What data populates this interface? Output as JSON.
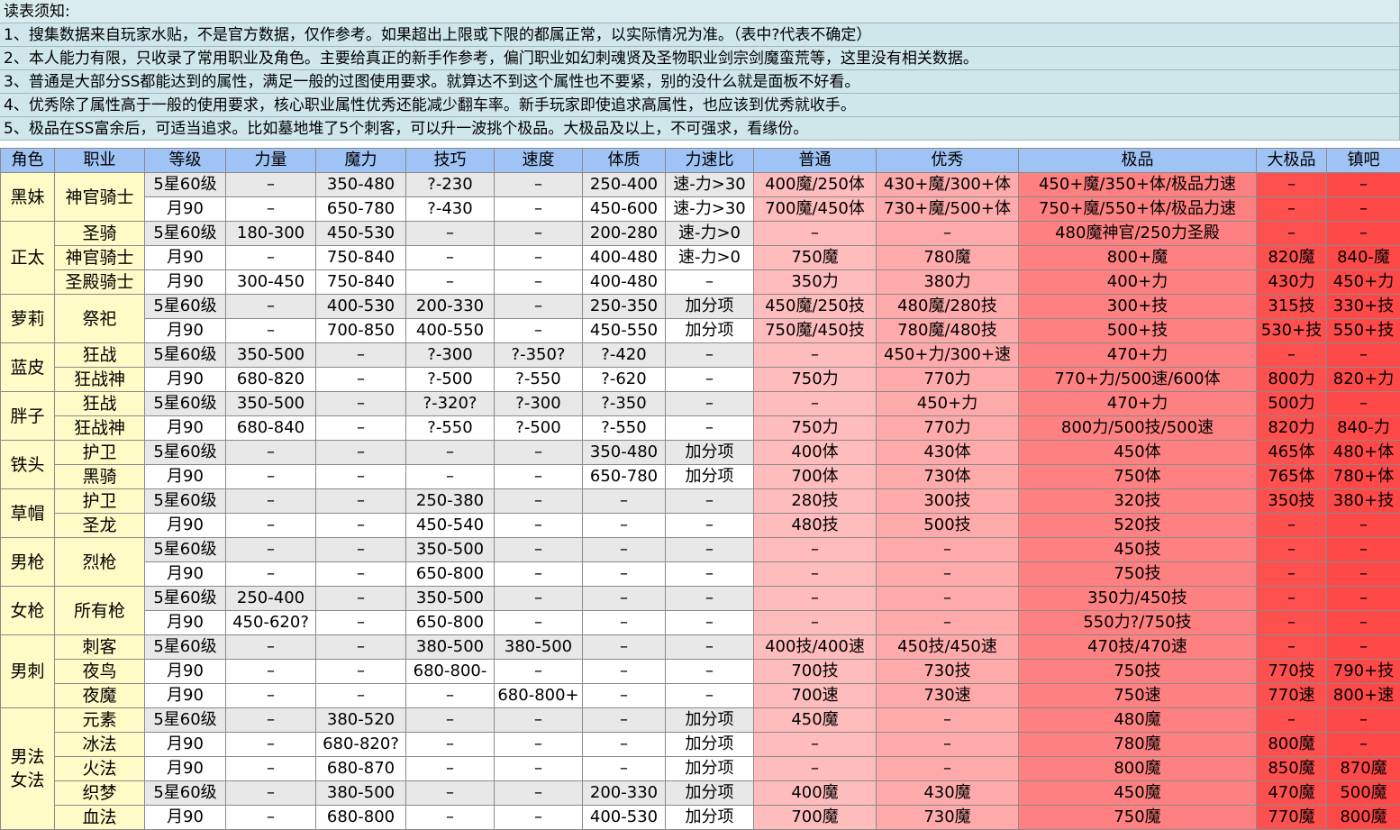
{
  "notes": [
    "读表须知:",
    "1、搜集数据来自玩家水贴，不是官方数据，仅作参考。如果超出上限或下限的都属正常，以实际情况为准。（表中?代表不确定）",
    "2、本人能力有限，只收录了常用职业及角色。主要给真正的新手作参考，偏门职业如幻刺魂贤及圣物职业剑宗剑魔蛮荒等，这里没有相关数据。",
    "3、普通是大部分SS都能达到的属性，满足一般的过图使用要求。就算达不到这个属性也不要紧，别的没什么就是面板不好看。",
    "4、优秀除了属性高于一般的使用要求，核心职业属性优秀还能减少翻车率。新手玩家即使追求高属性，也应该到优秀就收手。",
    "5、极品在SS富余后，可适当追求。比如墓地堆了5个刺客，可以升一波挑个极品。大极品及以上，不可强求，看缘份。"
  ],
  "headers": [
    "角色",
    "职业",
    "等级",
    "力量",
    "魔力",
    "技巧",
    "速度",
    "体质",
    "力速比",
    "普通",
    "优秀",
    "极品",
    "大极品",
    "镇吧"
  ],
  "rows": [
    {
      "role": "黑妹",
      "roleSpan": 2,
      "job": "神官骑士",
      "jobSpan": 2,
      "cells": [
        "5星60级",
        "–",
        "350-480",
        "?-230",
        "–",
        "250-400",
        "速-力>30",
        "400魔/250体",
        "430+魔/300+体",
        "450+魔/350+体/极品力速",
        "–",
        "–"
      ]
    },
    {
      "cells": [
        "月90",
        "–",
        "650-780",
        "?-430",
        "–",
        "450-600",
        "速-力>30",
        "700魔/450体",
        "730+魔/500+体",
        "750+魔/550+体/极品力速",
        "–",
        "–"
      ]
    },
    {
      "role": "正太",
      "roleSpan": 3,
      "job": "圣骑",
      "jobSpan": 1,
      "cells": [
        "5星60级",
        "180-300",
        "450-530",
        "–",
        "–",
        "200-280",
        "速-力>0",
        "–",
        "–",
        "480魔神官/250力圣殿",
        "–",
        "–"
      ]
    },
    {
      "job": "神官骑士",
      "jobSpan": 1,
      "cells": [
        "月90",
        "–",
        "750-840",
        "–",
        "–",
        "400-480",
        "速-力>0",
        "750魔",
        "780魔",
        "800+魔",
        "820魔",
        "840-魔"
      ]
    },
    {
      "job": "圣殿骑士",
      "jobSpan": 1,
      "cells": [
        "月90",
        "300-450",
        "750-840",
        "–",
        "–",
        "400-480",
        "–",
        "350力",
        "380力",
        "400+力",
        "430力",
        "450+力"
      ]
    },
    {
      "role": "萝莉",
      "roleSpan": 2,
      "job": "祭祀",
      "jobSpan": 2,
      "cells": [
        "5星60级",
        "–",
        "400-530",
        "200-330",
        "–",
        "250-350",
        "加分项",
        "450魔/250技",
        "480魔/280技",
        "300+技",
        "315技",
        "330+技"
      ]
    },
    {
      "cells": [
        "月90",
        "–",
        "700-850",
        "400-550",
        "–",
        "450-550",
        "加分项",
        "750魔/450技",
        "780魔/480技",
        "500+技",
        "530+技",
        "550+技"
      ]
    },
    {
      "role": "蓝皮",
      "roleSpan": 2,
      "job": "狂战",
      "jobSpan": 1,
      "cells": [
        "5星60级",
        "350-500",
        "–",
        "?-300",
        "?-350?",
        "?-420",
        "–",
        "–",
        "450+力/300+速",
        "470+力",
        "–",
        "–"
      ]
    },
    {
      "job": "狂战神",
      "jobSpan": 1,
      "cells": [
        "月90",
        "680-820",
        "–",
        "?-500",
        "?-550",
        "?-620",
        "–",
        "750力",
        "770力",
        "770+力/500速/600体",
        "800力",
        "820+力"
      ]
    },
    {
      "role": "胖子",
      "roleSpan": 2,
      "job": "狂战",
      "jobSpan": 1,
      "cells": [
        "5星60级",
        "350-500",
        "–",
        "?-320?",
        "?-300",
        "?-350",
        "–",
        "–",
        "450+力",
        "470+力",
        "500力",
        "–"
      ]
    },
    {
      "job": "狂战神",
      "jobSpan": 1,
      "cells": [
        "月90",
        "680-840",
        "–",
        "?-550",
        "?-500",
        "?-550",
        "–",
        "750力",
        "770力",
        "800力/500技/500速",
        "820力",
        "840-力"
      ]
    },
    {
      "role": "铁头",
      "roleSpan": 2,
      "job": "护卫",
      "jobSpan": 1,
      "cells": [
        "5星60级",
        "–",
        "–",
        "–",
        "–",
        "350-480",
        "加分项",
        "400体",
        "430体",
        "450体",
        "465体",
        "480+体"
      ]
    },
    {
      "job": "黑骑",
      "jobSpan": 1,
      "cells": [
        "月90",
        "–",
        "–",
        "–",
        "–",
        "650-780",
        "加分项",
        "700体",
        "730体",
        "750体",
        "765体",
        "780+体"
      ]
    },
    {
      "role": "草帽",
      "roleSpan": 2,
      "job": "护卫",
      "jobSpan": 1,
      "cells": [
        "5星60级",
        "–",
        "–",
        "250-380",
        "–",
        "–",
        "–",
        "280技",
        "300技",
        "320技",
        "350技",
        "380+技"
      ]
    },
    {
      "job": "圣龙",
      "jobSpan": 1,
      "cells": [
        "月90",
        "–",
        "–",
        "450-540",
        "–",
        "–",
        "–",
        "480技",
        "500技",
        "520技",
        "–",
        "–"
      ]
    },
    {
      "role": "男枪",
      "roleSpan": 2,
      "job": "烈枪",
      "jobSpan": 2,
      "cells": [
        "5星60级",
        "–",
        "–",
        "350-500",
        "–",
        "–",
        "–",
        "–",
        "–",
        "450技",
        "–",
        "–"
      ]
    },
    {
      "cells": [
        "月90",
        "–",
        "–",
        "650-800",
        "–",
        "–",
        "–",
        "–",
        "–",
        "750技",
        "–",
        "–"
      ]
    },
    {
      "role": "女枪",
      "roleSpan": 2,
      "job": "所有枪",
      "jobSpan": 2,
      "cells": [
        "5星60级",
        "250-400",
        "–",
        "350-500",
        "–",
        "–",
        "–",
        "–",
        "–",
        "350力/450技",
        "–",
        "–"
      ]
    },
    {
      "cells": [
        "月90",
        "450-620?",
        "–",
        "650-800",
        "–",
        "–",
        "–",
        "–",
        "–",
        "550力?/750技",
        "–",
        "–"
      ]
    },
    {
      "role": "男刺",
      "roleSpan": 3,
      "job": "刺客",
      "jobSpan": 1,
      "cells": [
        "5星60级",
        "–",
        "–",
        "380-500",
        "380-500",
        "–",
        "–",
        "400技/400速",
        "450技/450速",
        "470技/470速",
        "–",
        "–"
      ]
    },
    {
      "job": "夜鸟",
      "jobSpan": 1,
      "cells": [
        "月90",
        "–",
        "–",
        "680-800-",
        "–",
        "–",
        "–",
        "700技",
        "730技",
        "750技",
        "770技",
        "790+技"
      ]
    },
    {
      "job": "夜魔",
      "jobSpan": 1,
      "cells": [
        "月90",
        "–",
        "–",
        "–",
        "680-800+",
        "–",
        "–",
        "700速",
        "730速",
        "750速",
        "770速",
        "800+速"
      ]
    },
    {
      "role": "男法\n女法",
      "roleSpan": 5,
      "job": "元素",
      "jobSpan": 1,
      "cells": [
        "5星60级",
        "–",
        "380-520",
        "–",
        "–",
        "–",
        "加分项",
        "450魔",
        "–",
        "480魔",
        "–",
        "–"
      ]
    },
    {
      "job": "冰法",
      "jobSpan": 1,
      "cells": [
        "月90",
        "–",
        "680-820?",
        "–",
        "–",
        "–",
        "加分项",
        "–",
        "–",
        "780魔",
        "800魔",
        "–"
      ]
    },
    {
      "job": "火法",
      "jobSpan": 1,
      "cells": [
        "月90",
        "–",
        "680-870",
        "–",
        "–",
        "–",
        "加分项",
        "–",
        "–",
        "800魔",
        "850魔",
        "870魔"
      ]
    },
    {
      "job": "织梦",
      "jobSpan": 1,
      "cells": [
        "5星60级",
        "–",
        "380-500",
        "–",
        "–",
        "200-330",
        "加分项",
        "400魔",
        "430魔",
        "450魔",
        "470魔",
        "500魔"
      ]
    },
    {
      "job": "血法",
      "jobSpan": 1,
      "cells": [
        "月90",
        "–",
        "680-800",
        "–",
        "–",
        "400-530",
        "加分项",
        "700魔",
        "730魔",
        "750魔",
        "770魔",
        "800魔"
      ]
    }
  ]
}
